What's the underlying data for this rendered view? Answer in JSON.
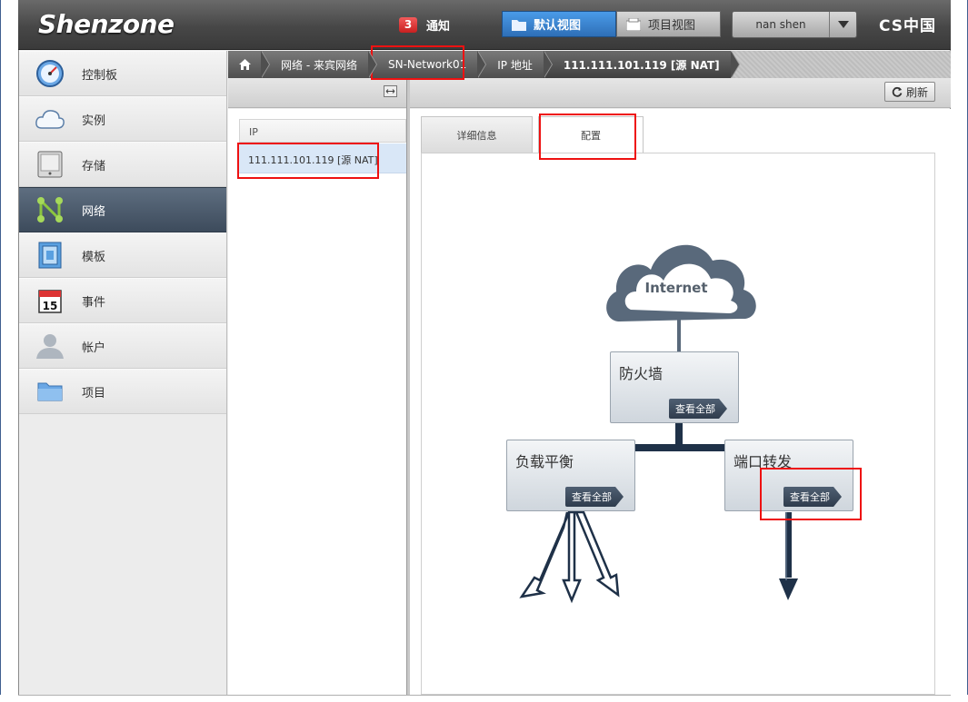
{
  "header": {
    "logo": "Shenzone",
    "notification_count": "3",
    "notification_label": "通知",
    "view_default": "默认视图",
    "view_project": "项目视图",
    "user": "nan shen",
    "brand": "CS中国"
  },
  "sidebar": {
    "items": [
      {
        "label": "控制板",
        "icon": "dashboard-icon"
      },
      {
        "label": "实例",
        "icon": "cloud-icon"
      },
      {
        "label": "存储",
        "icon": "storage-icon"
      },
      {
        "label": "网络",
        "icon": "network-icon"
      },
      {
        "label": "模板",
        "icon": "template-icon"
      },
      {
        "label": "事件",
        "icon": "calendar-icon"
      },
      {
        "label": "帐户",
        "icon": "account-icon"
      },
      {
        "label": "项目",
        "icon": "folder-icon"
      }
    ],
    "calendar_day": "15"
  },
  "breadcrumb": {
    "network": "网络 - 来宾网络",
    "network_name": "SN-Network01",
    "ip_section": "IP 地址",
    "current": "111.111.101.119 [源 NAT]"
  },
  "toolbar": {
    "refresh": "刷新"
  },
  "list": {
    "header": "IP",
    "rows": [
      "111.111.101.119 [源 NAT]"
    ]
  },
  "tabs": {
    "details": "详细信息",
    "config": "配置"
  },
  "diagram": {
    "internet": "Internet",
    "firewall": "防火墙",
    "load_balancer": "负载平衡",
    "port_forwarding": "端口转发",
    "view_all": "查看全部"
  },
  "colors": {
    "highlight": "#e11111",
    "active_nav": "#3d4b5c",
    "active_view": "#2e6fb7"
  }
}
